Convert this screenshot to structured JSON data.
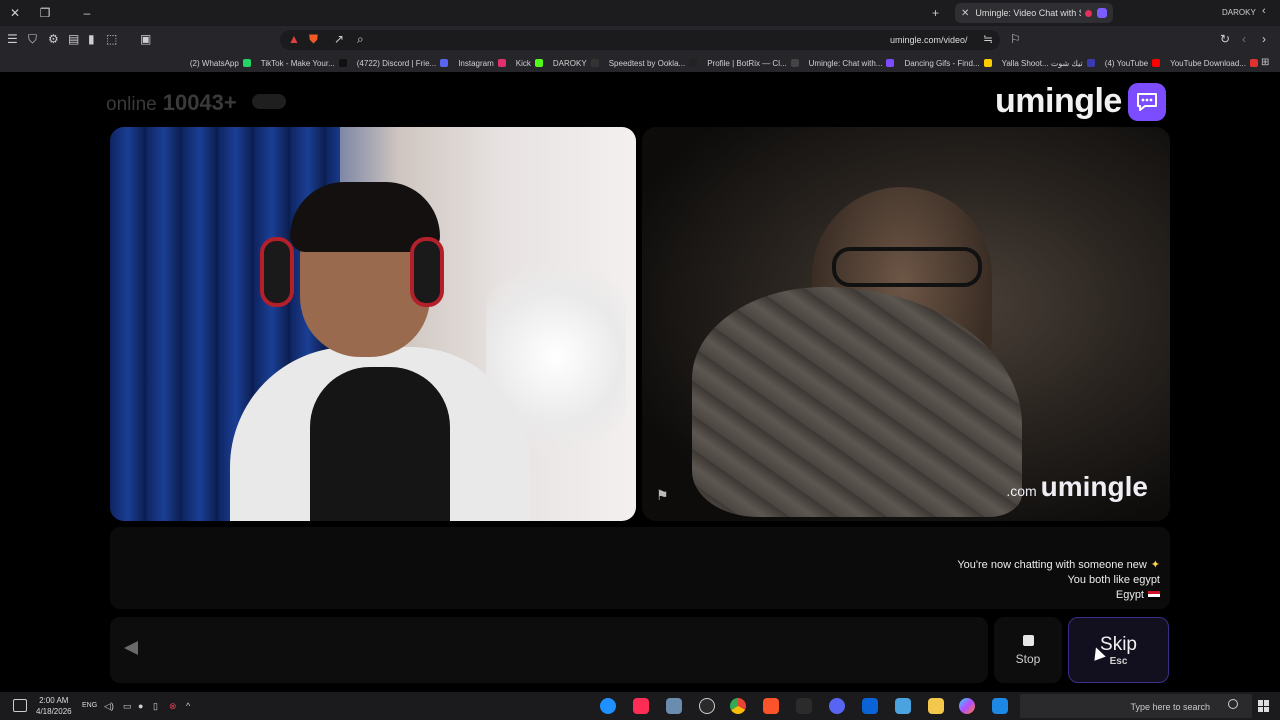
{
  "browser": {
    "tab_title": "Umingle: Video Chat with Str...",
    "profile_name": "DAROKY",
    "url": "umingle.com/video/",
    "bookmarks": [
      {
        "label": "(2) WhatsApp",
        "color": "#25d366"
      },
      {
        "label": "TikTok - Make Your...",
        "color": "#111111"
      },
      {
        "label": "(4722) Discord | Frie...",
        "color": "#5865f2"
      },
      {
        "label": "Instagram",
        "color": "#e1306c"
      },
      {
        "label": "Kick",
        "color": "#53fc18"
      },
      {
        "label": "DAROKY",
        "color": "#333333"
      },
      {
        "label": "Speedtest by Ookla...",
        "color": "#222222"
      },
      {
        "label": "Profile | BotRix — Cl...",
        "color": "#444444"
      },
      {
        "label": "Umingle: Chat with...",
        "color": "#7c4dff"
      },
      {
        "label": "Dancing Gifs - Find...",
        "color": "#ffcc00"
      },
      {
        "label": "Yalla Shoot... تيك شوت",
        "color": "#3a3ab0"
      },
      {
        "label": "(4) YouTube",
        "color": "#ff0000"
      },
      {
        "label": "YouTube Download...",
        "color": "#e03030"
      }
    ]
  },
  "header": {
    "online_count": "10043+",
    "online_label": "online",
    "logo_text": "umingle"
  },
  "video": {
    "watermark_main": "umingle",
    "watermark_domain": ".com"
  },
  "chat": {
    "messages": [
      "You're now chatting with someone new",
      "You both like egypt",
      "Egypt"
    ]
  },
  "controls": {
    "stop_label": "Stop",
    "skip_label": "Skip",
    "skip_shortcut": "Esc"
  },
  "taskbar": {
    "search_placeholder": "Type here to search",
    "time": "2:00 AM",
    "date": "4/18/2026",
    "language": "ENG"
  },
  "colors": {
    "brand": "#7c4dff",
    "skip_border": "#3a2f86"
  }
}
